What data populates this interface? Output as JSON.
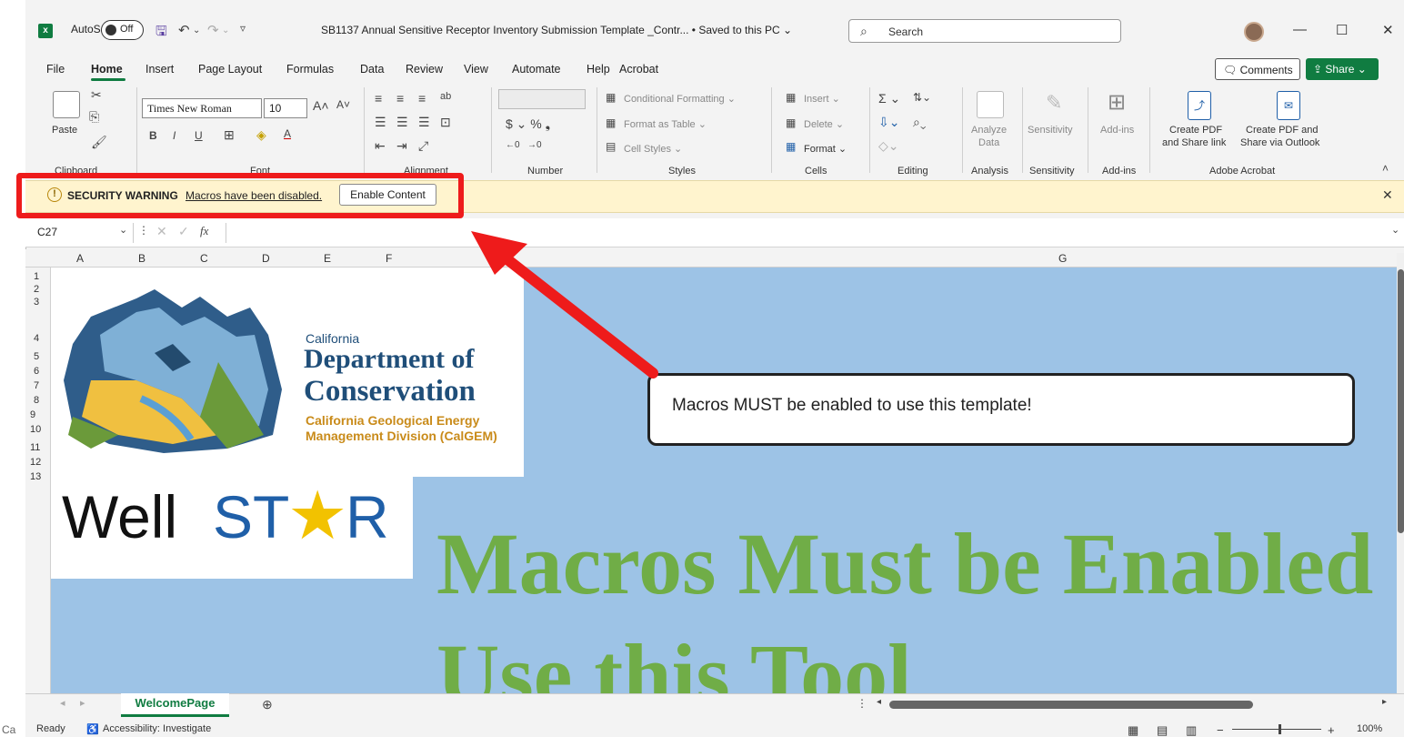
{
  "titlebar": {
    "autosave_label": "AutoSave",
    "autosave_state": "Off",
    "doc_title": "SB1137 Annual Sensitive Receptor Inventory Submission Template _Contr...  • Saved to this PC ⌄",
    "search_placeholder": "Search",
    "minimize": "—",
    "restore": "☐",
    "close": "✕"
  },
  "menu": {
    "tabs": [
      "File",
      "Home",
      "Insert",
      "Page Layout",
      "Formulas",
      "Data",
      "Review",
      "View",
      "Automate",
      "Help",
      "Acrobat"
    ],
    "comments_label": "Comments",
    "share_label": "Share ⌄"
  },
  "ribbon": {
    "font_name": "Times New Roman",
    "font_size": "10",
    "paste_label": "Paste",
    "groups": {
      "clipboard": "Clipboard",
      "font": "Font",
      "alignment": "Alignment",
      "number": "Number",
      "styles": "Styles",
      "cells": "Cells",
      "editing": "Editing",
      "analysis": "Analysis",
      "sensitivity": "Sensitivity",
      "addins": "Add-ins",
      "acrobat": "Adobe Acrobat"
    },
    "conditional_formatting": "Conditional Formatting ⌄",
    "format_as_table": "Format as Table ⌄",
    "cell_styles": "Cell Styles ⌄",
    "insert": "Insert ⌄",
    "delete": "Delete ⌄",
    "format": "Format ⌄",
    "analyze_data_1": "Analyze",
    "analyze_data_2": "Data",
    "sensitivity_btn": "Sensitivity",
    "addins_btn": "Add-ins",
    "create_pdf_1": "Create PDF",
    "create_pdf_2": "and Share link",
    "create_pdf_outlook_1": "Create PDF and",
    "create_pdf_outlook_2": "Share via Outlook",
    "number_symbols": "$ ⌄ % ❟"
  },
  "security": {
    "title": "SECURITY WARNING",
    "message": "Macros have been disabled.",
    "button": "Enable Content"
  },
  "formula_bar": {
    "cell_ref": "C27",
    "fx": "fx"
  },
  "grid": {
    "columns": [
      "A",
      "B",
      "C",
      "D",
      "E",
      "F",
      "G"
    ],
    "rows": [
      "1",
      "2",
      "3",
      "4",
      "5",
      "6",
      "7",
      "8",
      "9",
      "10",
      "11",
      "12",
      "13"
    ]
  },
  "sheet": {
    "logo_small": "California",
    "logo_line1": "Department of",
    "logo_line2": "Conservation",
    "logo_sub1": "California Geological Energy",
    "logo_sub2": "Management Division (CalGEM)",
    "wellstar_a": "Well",
    "wellstar_b": "ST",
    "wellstar_c": "R",
    "big_line1": "Macros Must be Enabled",
    "big_line2": "Use this Tool",
    "callout": "Macros MUST be enabled to use this template!"
  },
  "tabs": {
    "sheet_name": "WelcomePage",
    "add_sheet": "⊕"
  },
  "status": {
    "left_cut": "Ca",
    "ready": "Ready",
    "accessibility": "Accessibility: Investigate",
    "zoom": "100%"
  },
  "colors": {
    "excel_green": "#107c41",
    "sheet_blue": "#9dc3e6",
    "big_text_green": "#70ad47",
    "highlight_red": "#ee1b1b"
  }
}
